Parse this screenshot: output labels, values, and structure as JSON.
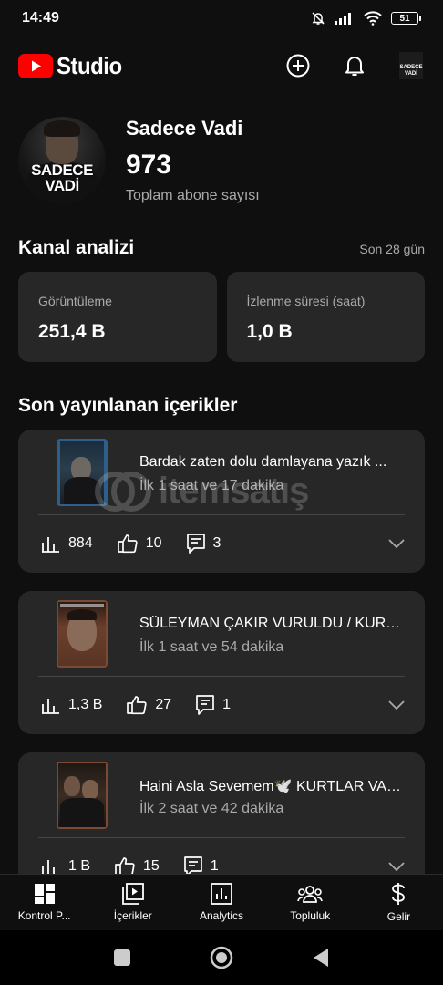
{
  "status_bar": {
    "time": "14:49",
    "battery": "51"
  },
  "app_bar": {
    "logo_text": "Studio",
    "avatar_line1": "SADECE",
    "avatar_line2": "VADİ"
  },
  "channel": {
    "avatar_line1": "SADECE",
    "avatar_line2": "VADİ",
    "name": "Sadece Vadi",
    "subscriber_count": "973",
    "subscriber_label": "Toplam abone sayısı"
  },
  "analytics": {
    "title": "Kanal analizi",
    "range": "Son 28 gün",
    "metrics": [
      {
        "label": "Görüntüleme",
        "value": "251,4 B"
      },
      {
        "label": "İzlenme süresi (saat)",
        "value": "1,0 B"
      }
    ]
  },
  "recent": {
    "title": "Son yayınlanan içerikler",
    "items": [
      {
        "title": "Bardak zaten dolu damlayana yazık ...",
        "time": "İlk 1 saat ve 17 dakika",
        "views": "884",
        "likes": "10",
        "comments": "3"
      },
      {
        "title": "SÜLEYMAN ÇAKIR VURULDU / KURTLAR VADİSİ",
        "time": "İlk 1 saat ve 54 dakika",
        "views": "1,3 B",
        "likes": "27",
        "comments": "1"
      },
      {
        "title": "Haini Asla Sevemem🕊️ KURTLAR VADİSİ",
        "time": "İlk 2 saat ve 42 dakika",
        "views": "1 B",
        "likes": "15",
        "comments": "1"
      }
    ]
  },
  "watermark": {
    "text": "itemsatış"
  },
  "bottom_nav": {
    "items": [
      {
        "label": "Kontrol P..."
      },
      {
        "label": "İçerikler"
      },
      {
        "label": "Analytics"
      },
      {
        "label": "Topluluk"
      },
      {
        "label": "Gelir"
      }
    ]
  },
  "colors": {
    "background": "#0f0f0f",
    "card": "#272727",
    "brand_red": "#ff0000",
    "secondary_text": "#aaaaaa"
  }
}
